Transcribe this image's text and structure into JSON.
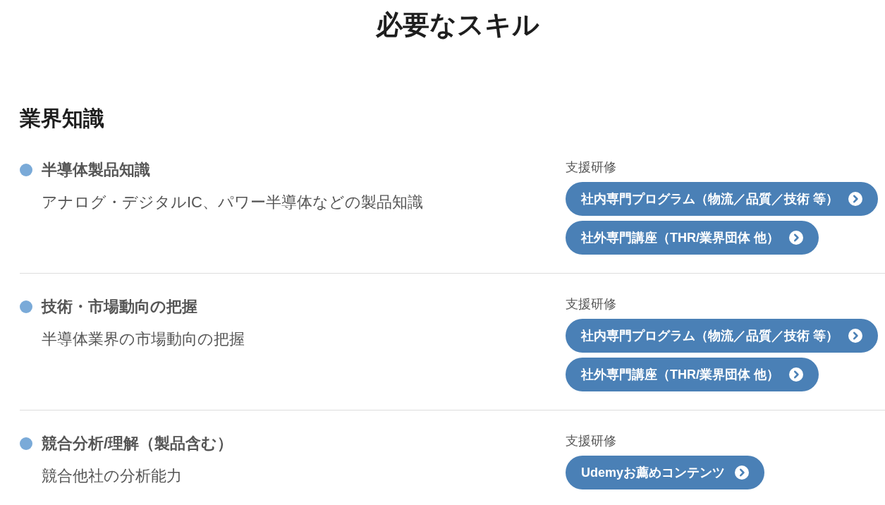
{
  "title": "必要なスキル",
  "sections": [
    {
      "heading": "業界知識",
      "skills": [
        {
          "name": "半導体製品知識",
          "description": "アナログ・デジタルIC、パワー半導体などの製品知識",
          "support_label": "支援研修",
          "trainings": [
            "社内専門プログラム（物流／品質／技術 等）",
            "社外専門講座（THR/業界団体 他）"
          ]
        },
        {
          "name": "技術・市場動向の把握",
          "description": "半導体業界の市場動向の把握",
          "support_label": "支援研修",
          "trainings": [
            "社内専門プログラム（物流／品質／技術 等）",
            "社外専門講座（THR/業界団体 他）"
          ]
        },
        {
          "name": "競合分析/理解（製品含む）",
          "description": "競合他社の分析能力",
          "support_label": "支援研修",
          "trainings": [
            "Udemyお薦めコンテンツ"
          ]
        }
      ]
    }
  ]
}
